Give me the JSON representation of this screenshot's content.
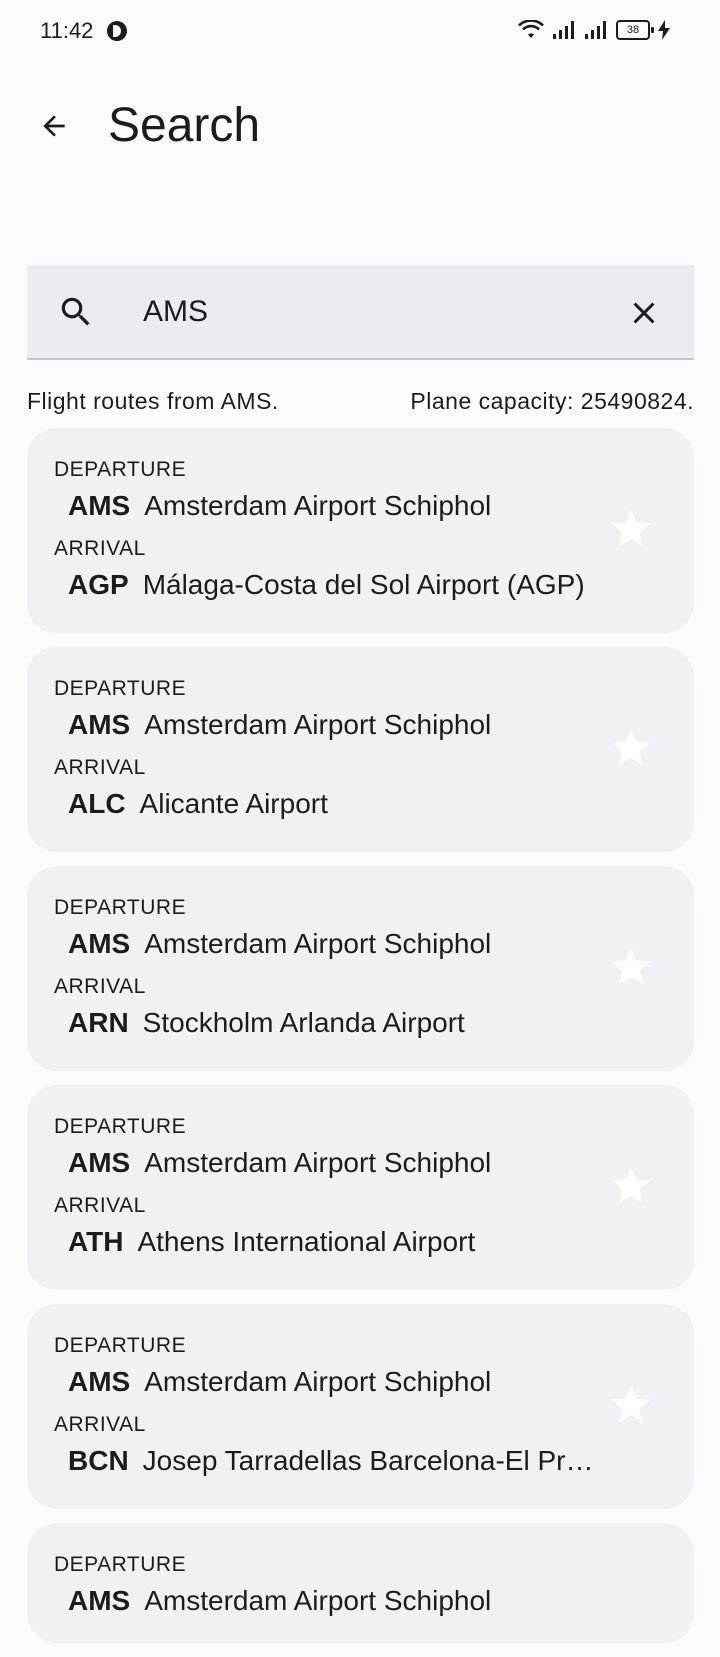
{
  "status_bar": {
    "time": "11:42",
    "battery": "38",
    "icons": [
      "dnd-icon",
      "wifi-icon",
      "signal-icon",
      "signal-icon",
      "battery-icon",
      "charging-icon"
    ]
  },
  "top_bar": {
    "title": "Search",
    "back_icon": "arrow-back-icon"
  },
  "search": {
    "value": "AMS",
    "icon": "search-icon",
    "clear_icon": "close-icon"
  },
  "info": {
    "routes_text": "Flight routes from AMS.",
    "capacity_text": "Plane capacity: 25490824."
  },
  "labels": {
    "departure": "DEPARTURE",
    "arrival": "ARRIVAL"
  },
  "routes": [
    {
      "dep_code": "AMS",
      "dep_name": "Amsterdam Airport Schiphol",
      "arr_code": "AGP",
      "arr_name": "Málaga-Costa del Sol Airport (AGP)"
    },
    {
      "dep_code": "AMS",
      "dep_name": "Amsterdam Airport Schiphol",
      "arr_code": "ALC",
      "arr_name": "Alicante Airport"
    },
    {
      "dep_code": "AMS",
      "dep_name": "Amsterdam Airport Schiphol",
      "arr_code": "ARN",
      "arr_name": "Stockholm Arlanda Airport"
    },
    {
      "dep_code": "AMS",
      "dep_name": "Amsterdam Airport Schiphol",
      "arr_code": "ATH",
      "arr_name": "Athens International Airport"
    },
    {
      "dep_code": "AMS",
      "dep_name": "Amsterdam Airport Schiphol",
      "arr_code": "BCN",
      "arr_name": "Josep Tarradellas Barcelona-El Prat Airport"
    },
    {
      "dep_code": "AMS",
      "dep_name": "Amsterdam Airport Schiphol"
    }
  ],
  "colors": {
    "background": "#fefbff",
    "card": "#f2eff5",
    "search_field": "#edeaf1",
    "text": "#1c1b1f",
    "star": "#ffffff"
  }
}
